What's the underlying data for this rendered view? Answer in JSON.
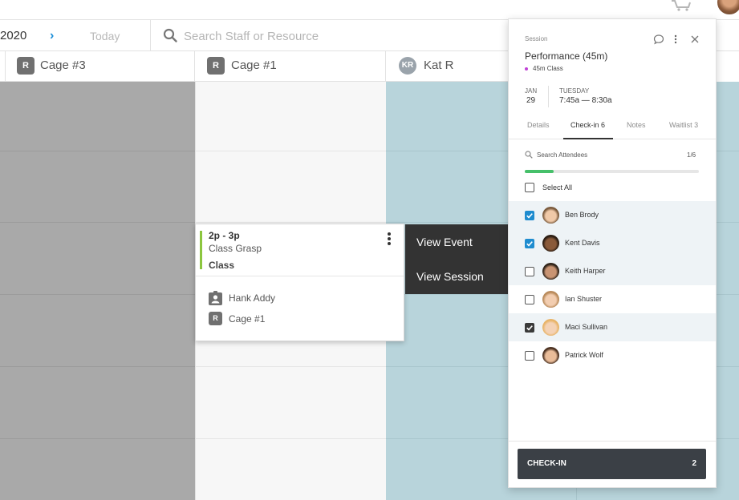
{
  "toolbar": {
    "date_fragment": "2020",
    "today_label": "Today",
    "search_placeholder": "Search Staff or Resource"
  },
  "columns": [
    {
      "badge": "R",
      "name": "Cage #3"
    },
    {
      "badge": "R",
      "name": "Cage #1"
    },
    {
      "badge": "KR",
      "name": "Kat R"
    }
  ],
  "event": {
    "time": "2p - 3p",
    "name": "Class Grasp",
    "type": "Class",
    "staff": "Hank Addy",
    "resource_badge": "R",
    "resource": "Cage #1"
  },
  "context_menu": {
    "view_event": "View Event",
    "view_session": "View Session"
  },
  "panel": {
    "kicker": "Session",
    "title": "Performance (45m)",
    "subtitle": "45m Class",
    "month": "JAN",
    "day": "29",
    "weekday": "TUESDAY",
    "time_range": "7:45a — 8:30a",
    "tabs": [
      "Details",
      "Check-in 6",
      "Notes",
      "Waitlist 3"
    ],
    "active_tab": "Check-in 6",
    "search_placeholder": "Search Attendees",
    "count": "1/6",
    "progress": 0.167,
    "select_all": "Select All",
    "attendees": [
      {
        "name": "Ben Brody",
        "checked": true
      },
      {
        "name": "Kent Davis",
        "checked": true
      },
      {
        "name": "Keith Harper",
        "checked": false
      },
      {
        "name": "Ian Shuster",
        "checked": false
      },
      {
        "name": "Maci Sullivan",
        "checked": true
      },
      {
        "name": "Patrick Wolf",
        "checked": false
      }
    ],
    "checkin_label": "CHECK-IN",
    "checkin_count": "2"
  },
  "colors": {
    "accent_blue": "#1f8ccf",
    "event_accent": "#8cc63f",
    "progress": "#46c06a",
    "column_grey": "#a9a9a9",
    "column_teal": "#b8d4db",
    "button_dark": "#3b4046"
  },
  "icons": [
    "cart-icon",
    "user-avatar",
    "chevron-right-icon",
    "search-icon",
    "comment-icon",
    "more-vertical-icon",
    "close-icon",
    "staff-badge-icon",
    "check-icon"
  ]
}
